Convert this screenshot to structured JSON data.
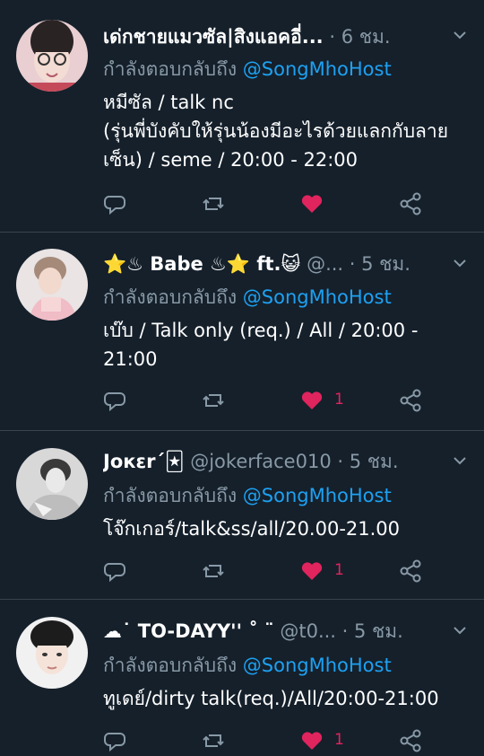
{
  "colors": {
    "background": "#15202b",
    "divider": "#38444d",
    "secondary_text": "#8899a6",
    "mention": "#1da1f2",
    "like": "#e0245e"
  },
  "tweets": [
    {
      "name": "เด่กชายแมวซัล|สิงแอคอี่...",
      "handle": "",
      "time": "· 6 ชม.",
      "reply_prefix": "กำลังตอบกลับถึง",
      "reply_to": "@SongMhoHost",
      "text": "หมีซัล / talk nc\n(รุ่นพี่บังคับให้รุ่นน้องมีอะไรด้วยแลกกับลายเซ็น) / seme / 20:00 - 22:00",
      "liked": true,
      "like_count": ""
    },
    {
      "name": "⭐♨ Babe ♨⭐ ft.😺",
      "handle": "@...",
      "time": "· 5 ชม.",
      "reply_prefix": "กำลังตอบกลับถึง",
      "reply_to": "@SongMhoHost",
      "text": "เบ๊บ / Talk only (req.) / All / 20:00 -\n21:00",
      "liked": true,
      "like_count": "1"
    },
    {
      "name": "Joкεr´🃏",
      "handle": "@jokerface010",
      "time": "· 5 ชม.",
      "reply_prefix": "กำลังตอบกลับถึง",
      "reply_to": "@SongMhoHost",
      "text": "โจ๊กเกอร์/talk&ss/all/20.00-21.00",
      "liked": true,
      "like_count": "1"
    },
    {
      "name": "☁˙  TO-DAYY'' ˚ ¨",
      "handle": "@t0...",
      "time": "· 5 ชม.",
      "reply_prefix": "กำลังตอบกลับถึง",
      "reply_to": "@SongMhoHost",
      "text": "ทูเดย์/dirty talk(req.)/All/20:00-21:00",
      "liked": true,
      "like_count": "1"
    }
  ],
  "icons": [
    "reply-icon",
    "retweet-icon",
    "like-icon",
    "share-icon",
    "chevron-down-icon"
  ]
}
